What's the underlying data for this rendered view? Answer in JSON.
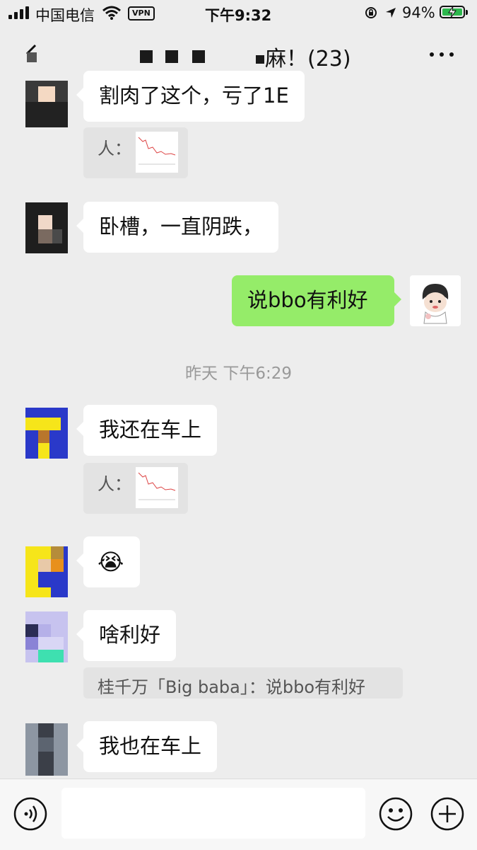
{
  "status_bar": {
    "carrier": "中国电信",
    "vpn": "VPN",
    "time": "下午9:32",
    "battery_percent": "94%"
  },
  "header": {
    "title": "麻！(23)"
  },
  "messages": [
    {
      "id": "m1",
      "side": "left",
      "text": "割肉了这个，亏了1E",
      "quote_prefix": "人："
    },
    {
      "id": "m2",
      "side": "left",
      "text": "卧槽，一直阴跌，"
    },
    {
      "id": "m3",
      "side": "right",
      "text": "说bbo有利好"
    },
    {
      "id": "m4",
      "side": "left",
      "text": "我还在车上",
      "quote_prefix": "人："
    },
    {
      "id": "m5",
      "side": "left",
      "emoji": "😭"
    },
    {
      "id": "m6",
      "side": "left",
      "text": "啥利好",
      "quote": "桂千万「Big baba」：说bbo有利好"
    },
    {
      "id": "m7",
      "side": "left",
      "text": "我也在车上"
    }
  ],
  "timestamp": "昨天 下午6:29",
  "colors": {
    "background": "#ededed",
    "bubble_self": "#95ec69",
    "bubble_other": "#ffffff"
  },
  "input_bar": {
    "icons": [
      "voice-icon",
      "emoji-icon",
      "plus-icon"
    ]
  }
}
